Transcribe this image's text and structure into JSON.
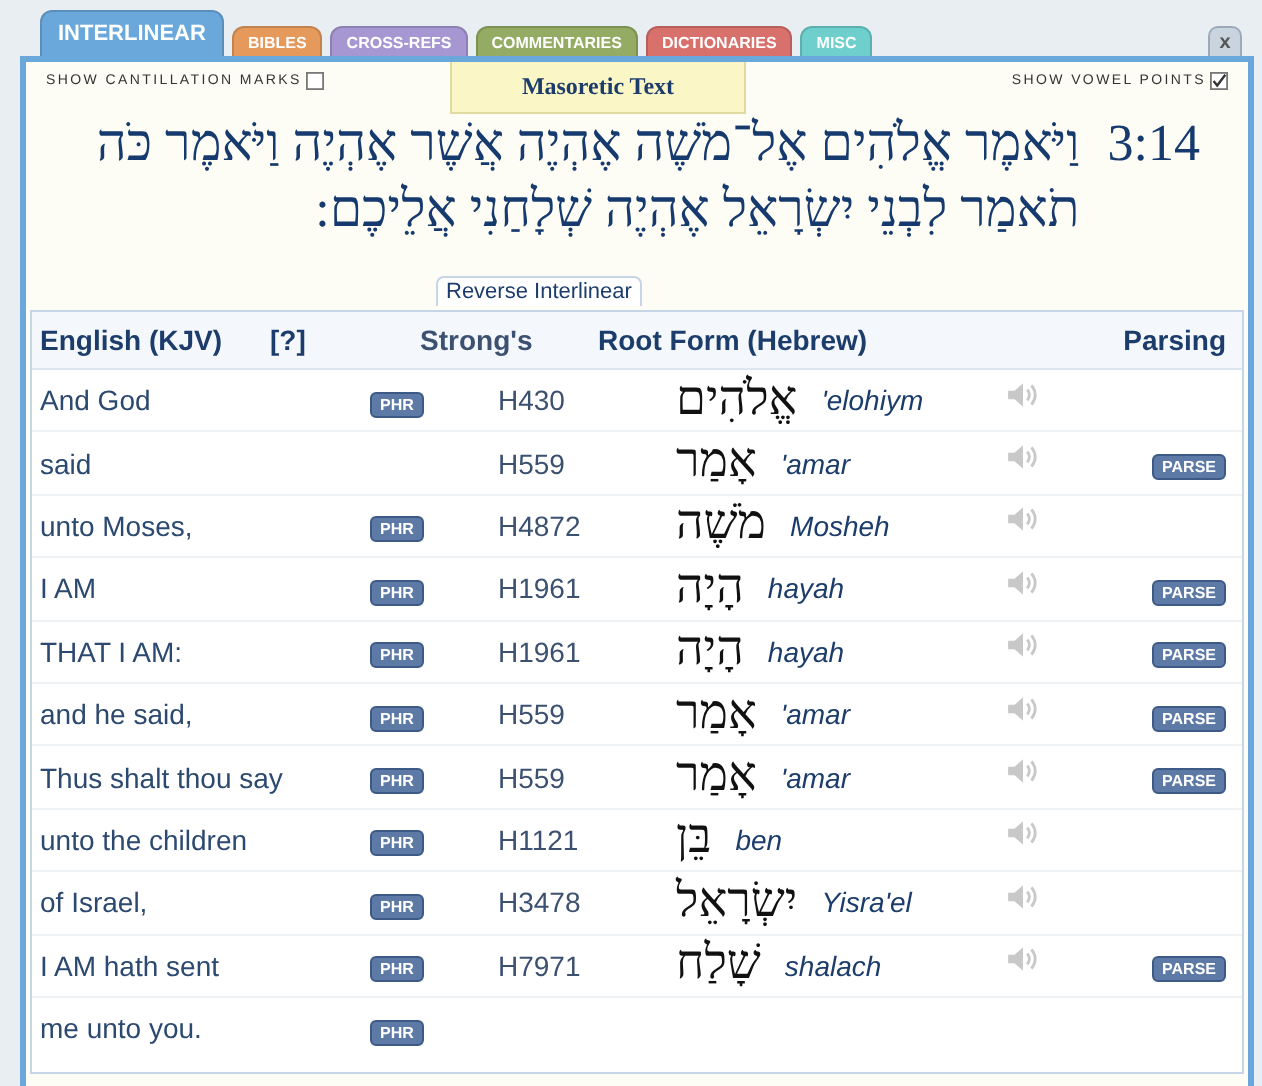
{
  "tabs": [
    {
      "label": "INTERLINEAR",
      "selected": true,
      "color": "#6aa8dc"
    },
    {
      "label": "BIBLES",
      "selected": false,
      "color": "#e59a5c"
    },
    {
      "label": "CROSS-REFS",
      "selected": false,
      "color": "#a697d2"
    },
    {
      "label": "COMMENTARIES",
      "selected": false,
      "color": "#93ab62"
    },
    {
      "label": "DICTIONARIES",
      "selected": false,
      "color": "#d8716b"
    },
    {
      "label": "MISC",
      "selected": false,
      "color": "#6ecfcc"
    }
  ],
  "close_label": "x",
  "options": [
    {
      "label": "SHOW CANTILLATION MARKS",
      "checked": false
    },
    {
      "label": "SHOW VOWEL POINTS",
      "checked": true
    }
  ],
  "text_label": "Masoretic Text",
  "verse": {
    "reference": "3:14",
    "text": "וַיֹּאמֶר אֱלֹהִים אֶל־מֹשֶׁה אֶהְיֶה אֲשֶׁר אֶהְיֶה וַיֹּאמֶר כֹּה תֹאמַר לִבְנֵי יִשְׂרָאֵל אֶהְיֶה שְׁלָחַנִי אֲלֵיכֶם:"
  },
  "table_label": "Reverse Interlinear",
  "columns": [
    "English (KJV)",
    "[?]",
    "Strong's",
    "Root Form (Hebrew)",
    "Parsing"
  ],
  "rows": [
    {
      "english": "And God",
      "phr": "PHR",
      "strongs": "H430",
      "hebrew": "אֱלֹהִים",
      "translit": "'elohiym",
      "audio": true
    },
    {
      "english": "said",
      "strongs": "H559",
      "hebrew": "אָמַר",
      "translit": "'amar",
      "audio": true,
      "parse": "PARSE"
    },
    {
      "english": "unto Moses,",
      "phr": "PHR",
      "strongs": "H4872",
      "hebrew": "מֹשֶׁה",
      "translit": "Mosheh",
      "audio": true
    },
    {
      "english": "I AM",
      "phr": "PHR",
      "strongs": "H1961",
      "hebrew": "הָיָה",
      "translit": "hayah",
      "audio": true,
      "parse": "PARSE"
    },
    {
      "english": "THAT I AM:",
      "phr": "PHR",
      "strongs": "H1961",
      "hebrew": "הָיָה",
      "translit": "hayah",
      "audio": true,
      "parse": "PARSE"
    },
    {
      "english": "and he said,",
      "phr": "PHR",
      "strongs": "H559",
      "hebrew": "אָמַר",
      "translit": "'amar",
      "audio": true,
      "parse": "PARSE"
    },
    {
      "english": "Thus shalt thou say",
      "phr": "PHR",
      "strongs": "H559",
      "hebrew": "אָמַר",
      "translit": "'amar",
      "audio": true,
      "parse": "PARSE"
    },
    {
      "english": "unto the children",
      "phr": "PHR",
      "strongs": "H1121",
      "hebrew": "בֵּן",
      "translit": "ben",
      "audio": true
    },
    {
      "english": "of Israel,",
      "phr": "PHR",
      "strongs": "H3478",
      "hebrew": "יִשְׂרָאֵל",
      "translit": "Yisra'el",
      "audio": true
    },
    {
      "english": "I AM hath sent",
      "phr": "PHR",
      "strongs": "H7971",
      "hebrew": "שָׁלַח",
      "translit": "shalach",
      "audio": true,
      "parse": "PARSE"
    },
    {
      "english": "me unto you.",
      "phr": "PHR"
    }
  ]
}
